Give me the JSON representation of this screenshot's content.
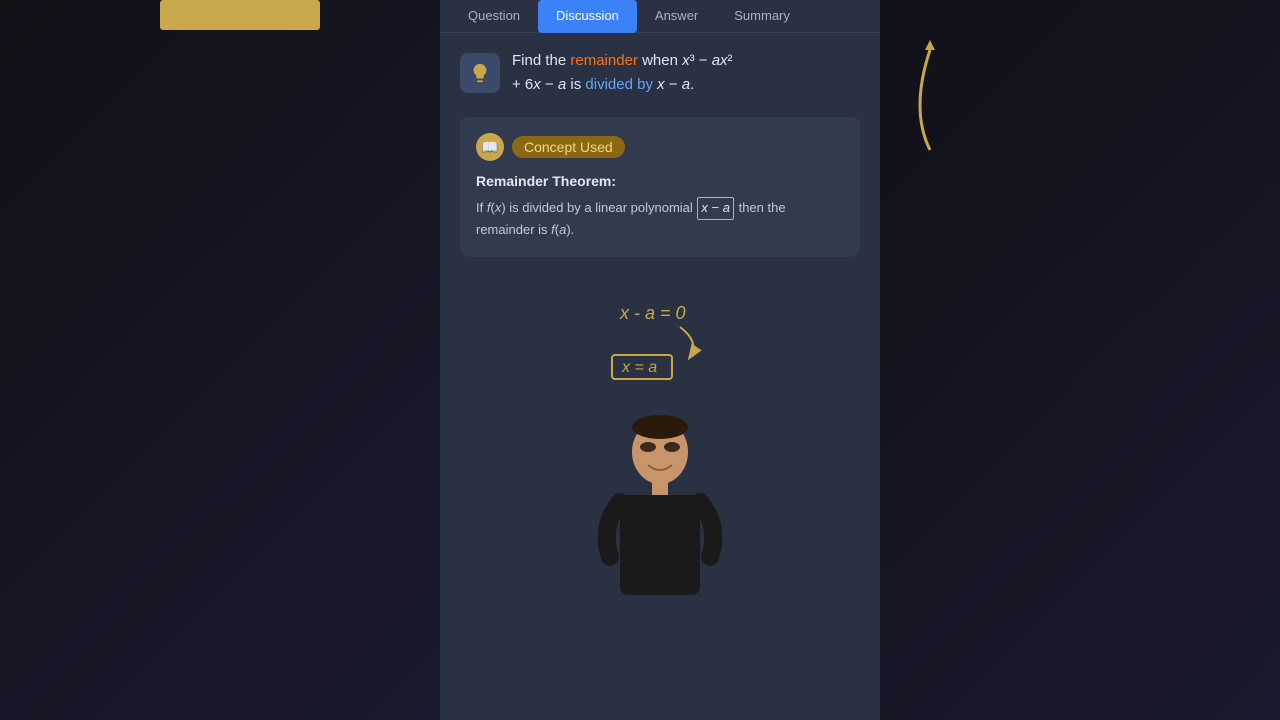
{
  "tabs": [
    {
      "label": "Question",
      "active": false
    },
    {
      "label": "Discussion",
      "active": true
    },
    {
      "label": "Answer",
      "active": false
    },
    {
      "label": "Summary",
      "active": false
    }
  ],
  "question": {
    "text_prefix": "Find the ",
    "highlight1": "remainder",
    "text_mid1": " when ",
    "math_expr1": "x³ − ax²",
    "text_mid2": "+ 6x − a is ",
    "highlight2": "divided by",
    "text_mid3": " x − a."
  },
  "concept": {
    "label": "Concept Used",
    "theorem_title": "Remainder Theorem:",
    "theorem_text_prefix": "If f(x) is divided by a linear polynomial ",
    "boxed_term": "x − a",
    "theorem_text_suffix": " then the remainder is f(a)."
  },
  "handwriting": {
    "line1": "x - a = 0",
    "line2": "x = a"
  },
  "icons": {
    "bulb": "💡",
    "book": "📖"
  }
}
